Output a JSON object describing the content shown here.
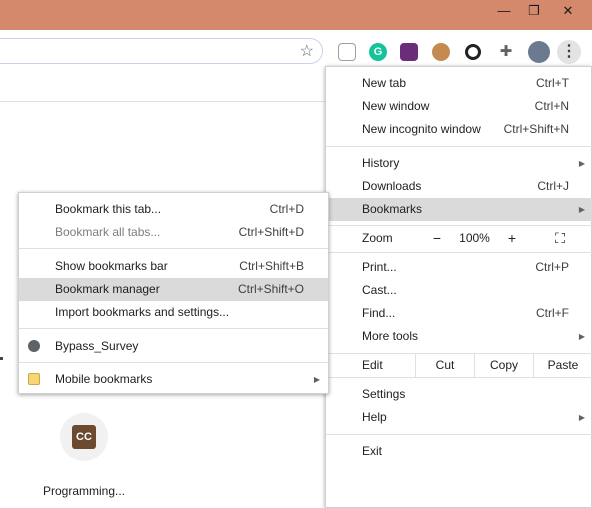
{
  "window": {
    "minimize": "—",
    "restore": "❐",
    "close": "✕"
  },
  "toolbar": {
    "star": "☆",
    "kebab": "⋮"
  },
  "extensions": [
    {
      "name": "ext-gray",
      "color": "#9aa0a6"
    },
    {
      "name": "grammarly",
      "color": "#15c39a"
    },
    {
      "name": "ext-purple",
      "color": "#6b2c7a"
    },
    {
      "name": "cookie",
      "color": "#a8703a"
    },
    {
      "name": "ext-dark",
      "color": "#222222"
    },
    {
      "name": "puzzle",
      "color": "#5f6368"
    },
    {
      "name": "avatar",
      "color": "#6b7a8f"
    }
  ],
  "chrome_menu": {
    "new_tab": {
      "label": "New tab",
      "shortcut": "Ctrl+T"
    },
    "new_window": {
      "label": "New window",
      "shortcut": "Ctrl+N"
    },
    "incognito": {
      "label": "New incognito window",
      "shortcut": "Ctrl+Shift+N"
    },
    "history": {
      "label": "History"
    },
    "downloads": {
      "label": "Downloads",
      "shortcut": "Ctrl+J"
    },
    "bookmarks": {
      "label": "Bookmarks"
    },
    "zoom": {
      "label": "Zoom",
      "minus": "−",
      "value": "100%",
      "plus": "+",
      "fullscreen": "⛶"
    },
    "print": {
      "label": "Print...",
      "shortcut": "Ctrl+P"
    },
    "cast": {
      "label": "Cast..."
    },
    "find": {
      "label": "Find...",
      "shortcut": "Ctrl+F"
    },
    "more_tools": {
      "label": "More tools"
    },
    "edit": {
      "label": "Edit",
      "cut": "Cut",
      "copy": "Copy",
      "paste": "Paste"
    },
    "settings": {
      "label": "Settings"
    },
    "help": {
      "label": "Help"
    },
    "exit": {
      "label": "Exit"
    }
  },
  "bookmarks_menu": {
    "bookmark_tab": {
      "label": "Bookmark this tab...",
      "shortcut": "Ctrl+D"
    },
    "bookmark_all": {
      "label": "Bookmark all tabs...",
      "shortcut": "Ctrl+Shift+D"
    },
    "show_bar": {
      "label": "Show bookmarks bar",
      "shortcut": "Ctrl+Shift+B"
    },
    "manager": {
      "label": "Bookmark manager",
      "shortcut": "Ctrl+Shift+O"
    },
    "import": {
      "label": "Import bookmarks and settings..."
    },
    "bypass": {
      "label": "Bypass_Survey"
    },
    "mobile": {
      "label": "Mobile bookmarks"
    }
  },
  "page": {
    "tile_icon": "CC",
    "tile_label": "Programming..."
  }
}
